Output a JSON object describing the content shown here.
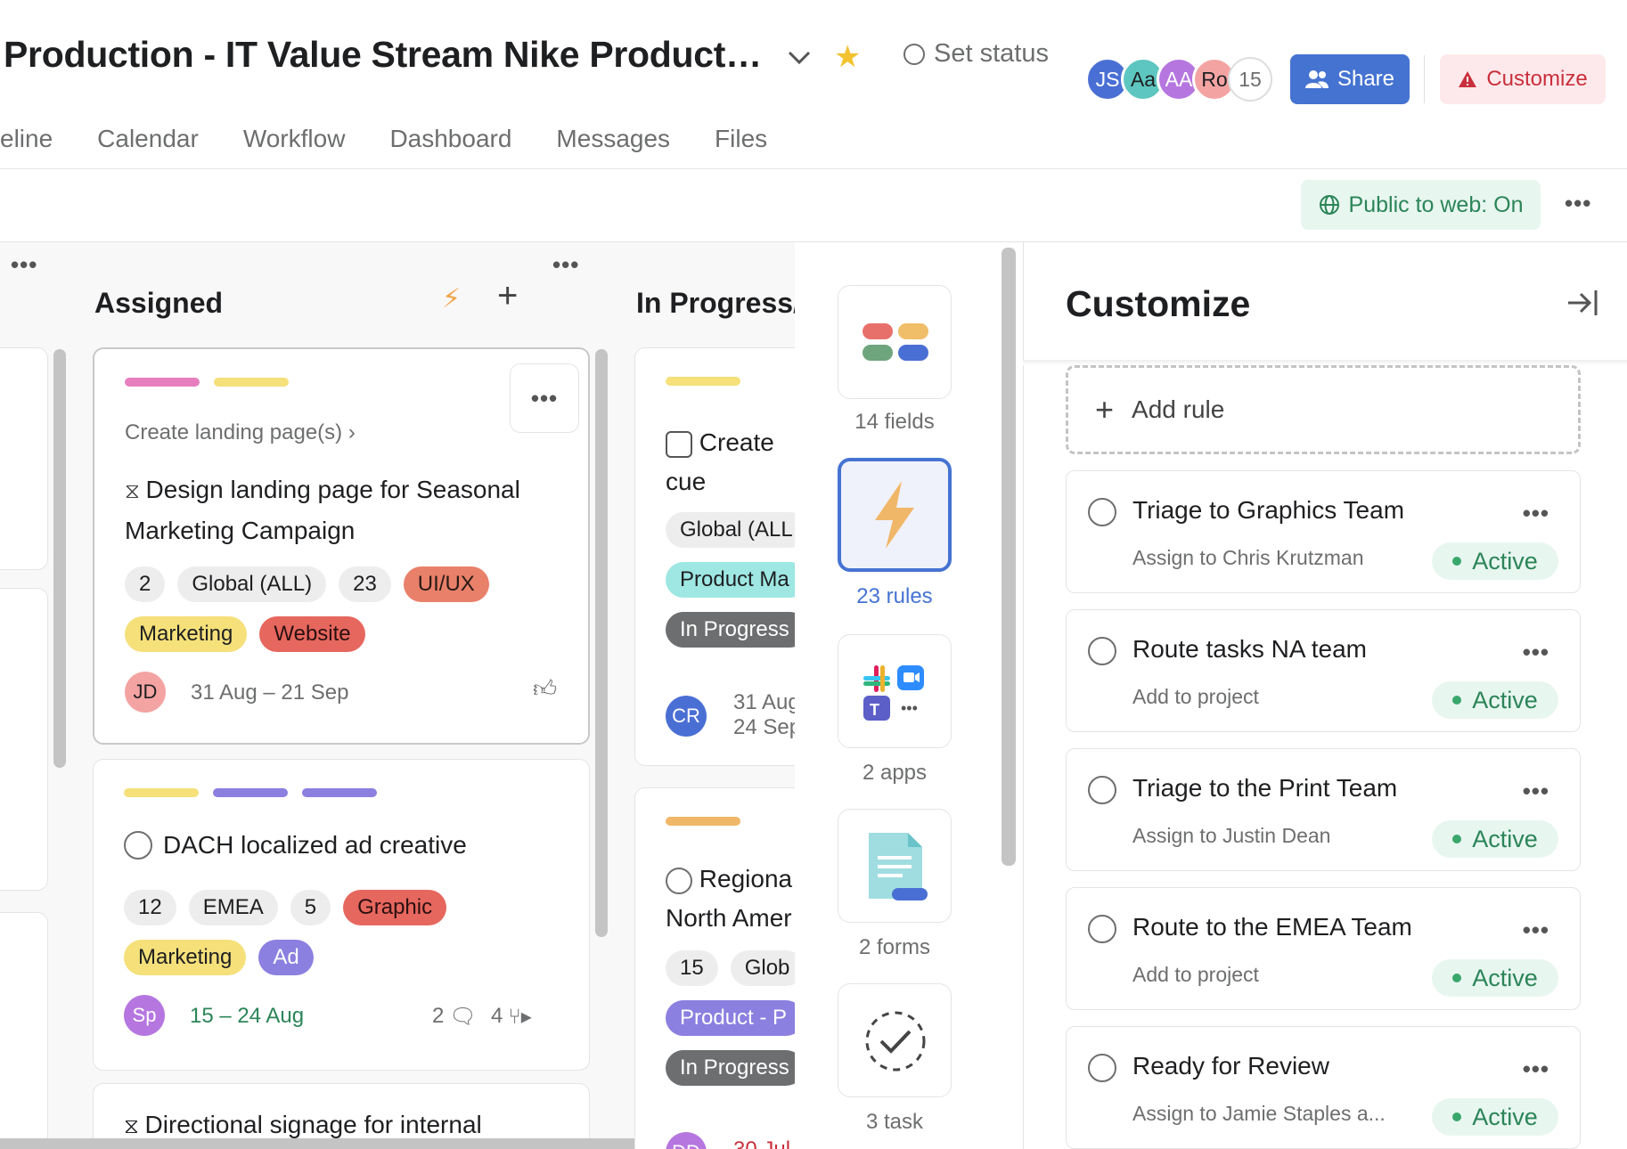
{
  "header": {
    "title": "Production - IT Value Stream Nike Product Air...",
    "set_status": "Set status",
    "member_count": "15",
    "share_label": "Share",
    "customize_label": "Customize"
  },
  "avatars": [
    {
      "initials": "JS",
      "color": "#4a6fd4"
    },
    {
      "initials": "Aa",
      "color": "#5ec6c0"
    },
    {
      "initials": "AA",
      "color": "#b676e0"
    },
    {
      "initials": "Ro",
      "color": "#f4a3a3"
    }
  ],
  "tabs": [
    "eline",
    "Calendar",
    "Workflow",
    "Dashboard",
    "Messages",
    "Files"
  ],
  "subbar": {
    "public_label": "Public to web: On"
  },
  "board": {
    "columns": [
      {
        "title": "Assigned"
      },
      {
        "title": "In Progress/"
      }
    ],
    "cards": [
      {
        "parent": "Create landing page(s)",
        "title": "Design landing page for Seasonal Marketing Campaign",
        "pills_row1": [
          "2",
          "Global (ALL)",
          "23",
          "UI/UX"
        ],
        "pills_row2": [
          "Marketing",
          "Website"
        ],
        "assignee": "JD",
        "dates": "31 Aug – 21 Sep"
      },
      {
        "title": "DACH localized ad creative",
        "pills_row1": [
          "12",
          "EMEA",
          "5",
          "Graphic"
        ],
        "pills_row2": [
          "Marketing",
          "Ad"
        ],
        "assignee": "Sp",
        "dates": "15 – 24 Aug",
        "comments": "2",
        "subtasks": "4"
      },
      {
        "title": "Directional signage for internal"
      }
    ],
    "col2_cards": [
      {
        "title_l1": "Create",
        "title_l2": "cue",
        "pills": [
          "Global (ALL",
          "Product Ma",
          "In Progress"
        ],
        "assignee": "CR",
        "date1": "31 Aug",
        "date2": "24 Sep"
      },
      {
        "title_l1": "Regiona",
        "title_l2": "North Amer",
        "pills_row1": [
          "15",
          "Glob"
        ],
        "pills": [
          "Product - P",
          "In Progress"
        ],
        "assignee": "DD",
        "date1": "30 Jul"
      }
    ]
  },
  "sidebar": [
    {
      "label": "14 fields"
    },
    {
      "label": "23 rules"
    },
    {
      "label": "2 apps"
    },
    {
      "label": "2 forms"
    },
    {
      "label": "3 task"
    }
  ],
  "panel": {
    "title": "Customize",
    "add_rule": "Add rule",
    "rules": [
      {
        "name": "Triage to Graphics Team",
        "sub": "Assign to Chris Krutzman",
        "status": "Active"
      },
      {
        "name": "Route tasks NA team",
        "sub": "Add to project",
        "status": "Active"
      },
      {
        "name": "Triage to the Print Team",
        "sub": "Assign to Justin Dean",
        "status": "Active"
      },
      {
        "name": "Route to the EMEA Team",
        "sub": "Add to project",
        "status": "Active"
      },
      {
        "name": "Ready for Review",
        "sub": "Assign to Jamie Staples a...",
        "status": "Active"
      }
    ]
  }
}
